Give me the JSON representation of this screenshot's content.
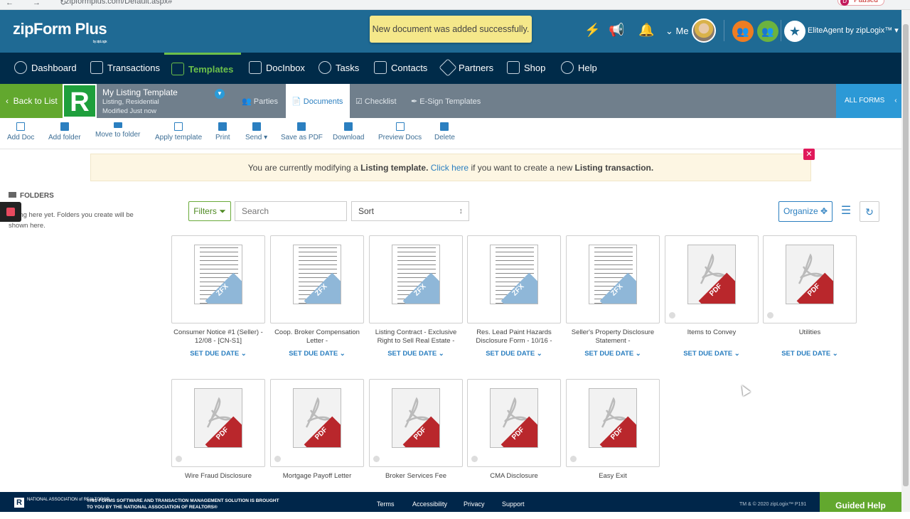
{
  "browser": {
    "nav_glyphs": "← → ↻",
    "url": "zipformplus.com/Default.aspx#",
    "paused": "Paused"
  },
  "header": {
    "logo": "zipForm Plus",
    "logo_sub": "by zipLogix",
    "toast": "New document was added successfully.",
    "me": "Me",
    "elite": "EliteAgent by zipLogix™"
  },
  "mainnav": [
    {
      "label": "Dashboard"
    },
    {
      "label": "Transactions"
    },
    {
      "label": "Templates"
    },
    {
      "label": "DocInbox"
    },
    {
      "label": "Tasks"
    },
    {
      "label": "Contacts"
    },
    {
      "label": "Partners"
    },
    {
      "label": "Shop"
    },
    {
      "label": "Help"
    }
  ],
  "subbar": {
    "back": "Back to List",
    "badge": "R",
    "title": "My Listing Template",
    "type": "Listing, Residential",
    "modified": "Modified Just now",
    "tabs": [
      "Parties",
      "Documents",
      "Checklist",
      "E-Sign Templates"
    ],
    "all_forms": "ALL FORMS"
  },
  "toolbar": [
    "Add Doc",
    "Add folder",
    "Move to folder",
    "Apply template",
    "Print",
    "Send",
    "Save as PDF",
    "Download",
    "Preview Docs",
    "Delete"
  ],
  "notice": {
    "pre": "You are currently modifying a ",
    "bold1": "Listing template.",
    "link": " Click here",
    "mid": " if you want to create a new ",
    "bold2": "Listing transaction."
  },
  "folders": {
    "title": "FOLDERS",
    "empty": "...hing here yet. Folders you create will be shown here."
  },
  "controls": {
    "filters": "Filters",
    "search_placeholder": "Search",
    "sort": "Sort",
    "organize": "Organize"
  },
  "docs": [
    {
      "name": "Consumer Notice #1 (Seller) - 12/08 - [CN-S1]",
      "type": "ZFX",
      "due": "SET DUE DATE"
    },
    {
      "name": "Coop. Broker Compensation Letter -",
      "type": "ZFX",
      "due": "SET DUE DATE"
    },
    {
      "name": "Listing Contract - Exclusive Right to Sell Real Estate -",
      "type": "ZFX",
      "due": "SET DUE DATE"
    },
    {
      "name": "Res. Lead Paint Hazards Disclosure Form - 10/16 -",
      "type": "ZFX",
      "due": "SET DUE DATE"
    },
    {
      "name": "Seller's Property Disclosure Statement -",
      "type": "ZFX",
      "due": "SET DUE DATE"
    },
    {
      "name": "Items to Convey",
      "type": "PDF",
      "due": "SET DUE DATE"
    },
    {
      "name": "Utilities",
      "type": "PDF",
      "due": "SET DUE DATE"
    },
    {
      "name": "Wire Fraud Disclosure",
      "type": "PDF",
      "due": ""
    },
    {
      "name": "Mortgage Payoff Letter",
      "type": "PDF",
      "due": ""
    },
    {
      "name": "Broker Services Fee",
      "type": "PDF",
      "due": ""
    },
    {
      "name": "CMA Disclosure",
      "type": "PDF",
      "due": ""
    },
    {
      "name": "Easy Exit",
      "type": "PDF",
      "due": ""
    }
  ],
  "footer": {
    "nar": "NATIONAL ASSOCIATION of REALTORS®",
    "brought": "THIS FORMS SOFTWARE AND TRANSACTION MANAGEMENT SOLUTION IS BROUGHT TO YOU BY THE NATIONAL ASSOCIATION OF REALTORS®",
    "links": [
      "Terms",
      "Accessibility",
      "Privacy",
      "Support"
    ],
    "copyright": "TM & © 2020 zipLogix™ P191",
    "guided": "Guided Help"
  }
}
